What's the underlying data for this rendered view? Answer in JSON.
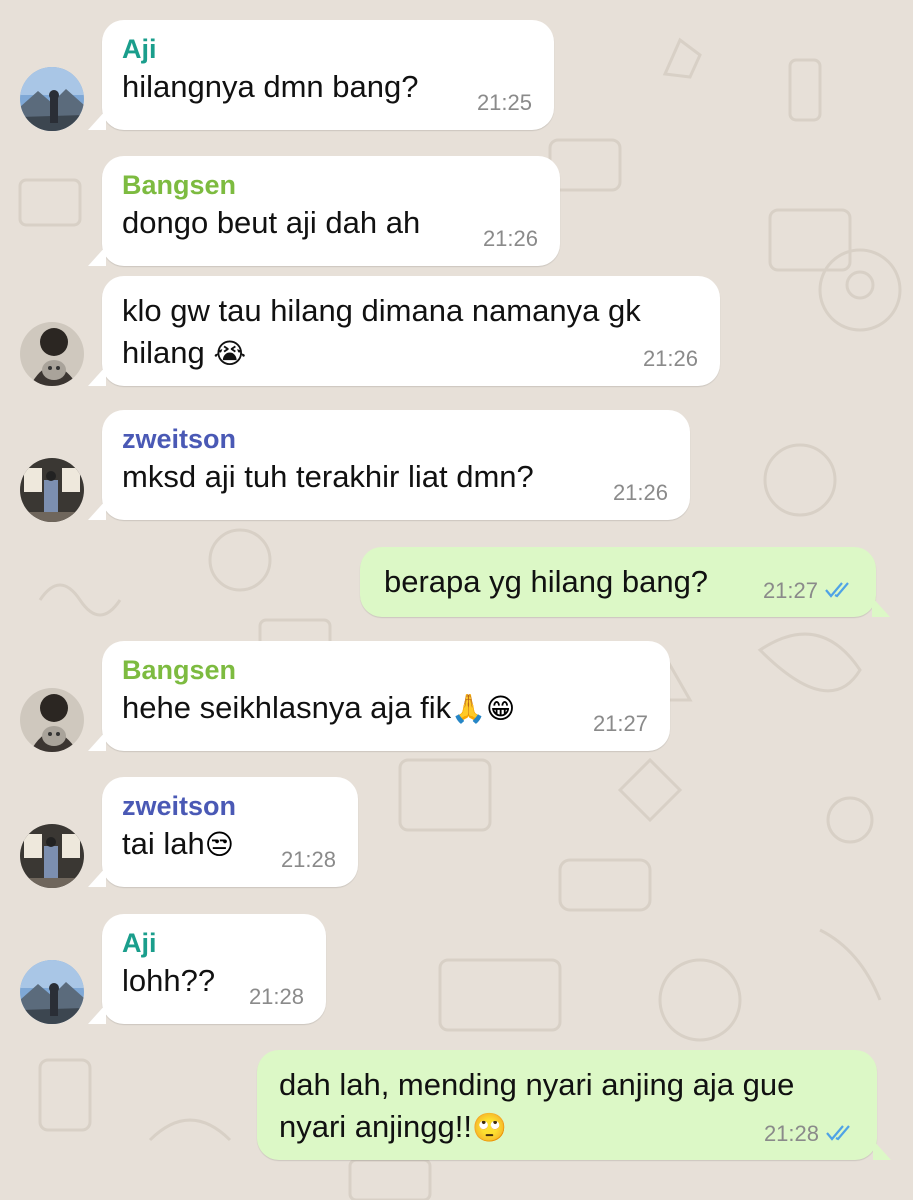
{
  "colors": {
    "background": "#e7e0d8",
    "incoming_bubble": "#ffffff",
    "outgoing_bubble": "#dcf8c6",
    "name_aji": "#1a9e8c",
    "name_bangsen": "#7dbb40",
    "name_zweitson": "#4a59b5",
    "timestamp": "#8a8a8a",
    "read_ticks": "#4fa3e6"
  },
  "messages": [
    {
      "direction": "in",
      "sender": "Aji",
      "avatar": "mountain-avatar",
      "text": "hilangnya dmn bang?",
      "time": "21:25"
    },
    {
      "direction": "in",
      "sender": "Bangsen",
      "text": "dongo beut aji dah ah",
      "time": "21:26"
    },
    {
      "direction": "in",
      "sender": "",
      "avatar": "person-with-cat-avatar",
      "text": "klo gw tau hilang dimana namanya gk",
      "text2": "hilang",
      "emoji": "😭",
      "time": "21:26"
    },
    {
      "direction": "in",
      "sender": "zweitson",
      "avatar": "gallery-avatar",
      "text": "mksd aji tuh terakhir liat dmn?",
      "time": "21:26"
    },
    {
      "direction": "out",
      "text": "berapa yg hilang bang?",
      "time": "21:27",
      "status": "read-double-check-icon"
    },
    {
      "direction": "in",
      "sender": "Bangsen",
      "avatar": "person-with-cat-avatar",
      "text": "hehe seikhlasnya aja fik",
      "emoji": "🙏😁",
      "time": "21:27"
    },
    {
      "direction": "in",
      "sender": "zweitson",
      "avatar": "gallery-avatar",
      "text": "tai lah",
      "emoji": "😒",
      "time": "21:28"
    },
    {
      "direction": "in",
      "sender": "Aji",
      "avatar": "mountain-avatar",
      "text": "lohh??",
      "time": "21:28"
    },
    {
      "direction": "out",
      "text": "dah lah, mending nyari anjing aja gue",
      "text2": "nyari anjingg!!",
      "emoji": "🙄",
      "time": "21:28",
      "status": "read-double-check-icon"
    }
  ]
}
